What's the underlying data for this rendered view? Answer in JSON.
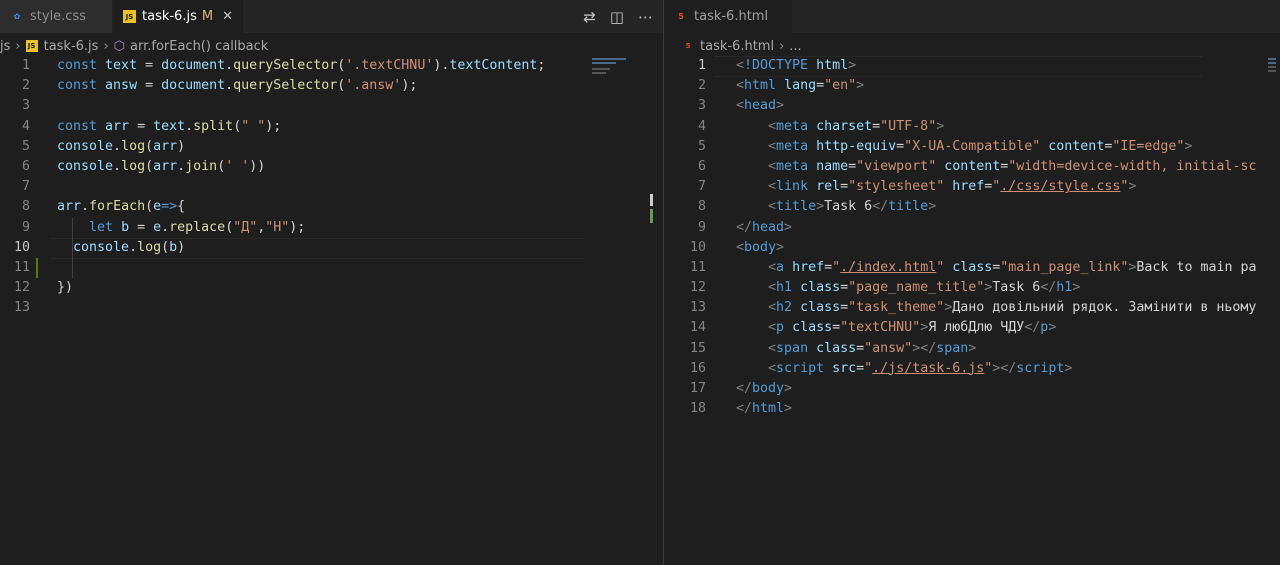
{
  "left": {
    "tabs": [
      {
        "label": "style.css",
        "icon": "css",
        "active": false
      },
      {
        "label": "task-6.js",
        "icon": "js",
        "active": true,
        "modified": "M",
        "close": "✕"
      }
    ],
    "actions": [
      "compare-icon",
      "split-editor-icon",
      "more-icon"
    ],
    "breadcrumb": {
      "folder": "js",
      "file": "task-6.js",
      "symbol": "arr.forEach() callback"
    },
    "current_line": 10
  },
  "right": {
    "tabs": [
      {
        "label": "task-6.html",
        "icon": "html",
        "active": true
      }
    ],
    "breadcrumb": {
      "file": "task-6.html",
      "rest": "..."
    },
    "current_line": 1
  },
  "js_lines": [
    {
      "n": "1",
      "tokens": [
        [
          "k",
          "const "
        ],
        [
          "v",
          "text"
        ],
        [
          "p",
          " = "
        ],
        [
          "v",
          "document"
        ],
        [
          "p",
          "."
        ],
        [
          "f",
          "querySelector"
        ],
        [
          "p",
          "("
        ],
        [
          "s",
          "'.textCHNU'"
        ],
        [
          "p",
          ")."
        ],
        [
          "v",
          "textContent"
        ],
        [
          "p",
          ";"
        ]
      ]
    },
    {
      "n": "2",
      "tokens": [
        [
          "k",
          "const "
        ],
        [
          "v",
          "answ"
        ],
        [
          "p",
          " = "
        ],
        [
          "v",
          "document"
        ],
        [
          "p",
          "."
        ],
        [
          "f",
          "querySelector"
        ],
        [
          "p",
          "("
        ],
        [
          "s",
          "'.answ'"
        ],
        [
          "p",
          ");"
        ]
      ]
    },
    {
      "n": "3",
      "tokens": []
    },
    {
      "n": "4",
      "tokens": [
        [
          "k",
          "const "
        ],
        [
          "v",
          "arr"
        ],
        [
          "p",
          " = "
        ],
        [
          "v",
          "text"
        ],
        [
          "p",
          "."
        ],
        [
          "f",
          "split"
        ],
        [
          "p",
          "("
        ],
        [
          "s",
          "\" \""
        ],
        [
          "p",
          ");"
        ]
      ]
    },
    {
      "n": "5",
      "tokens": [
        [
          "v",
          "console"
        ],
        [
          "p",
          "."
        ],
        [
          "f",
          "log"
        ],
        [
          "p",
          "("
        ],
        [
          "v",
          "arr"
        ],
        [
          "p",
          ")"
        ]
      ]
    },
    {
      "n": "6",
      "tokens": [
        [
          "v",
          "console"
        ],
        [
          "p",
          "."
        ],
        [
          "f",
          "log"
        ],
        [
          "p",
          "("
        ],
        [
          "v",
          "arr"
        ],
        [
          "p",
          "."
        ],
        [
          "f",
          "join"
        ],
        [
          "p",
          "("
        ],
        [
          "s",
          "' '"
        ],
        [
          "p",
          "))"
        ]
      ]
    },
    {
      "n": "7",
      "tokens": []
    },
    {
      "n": "8",
      "tokens": [
        [
          "v",
          "arr"
        ],
        [
          "p",
          "."
        ],
        [
          "f",
          "forEach"
        ],
        [
          "p",
          "("
        ],
        [
          "v",
          "e"
        ],
        [
          "k",
          "=>"
        ],
        [
          "p",
          "{"
        ]
      ]
    },
    {
      "n": "9",
      "tokens": [
        [
          "p",
          "    "
        ],
        [
          "k",
          "let "
        ],
        [
          "v",
          "b"
        ],
        [
          "p",
          " = "
        ],
        [
          "v",
          "e"
        ],
        [
          "p",
          "."
        ],
        [
          "f",
          "replace"
        ],
        [
          "p",
          "("
        ],
        [
          "s",
          "\"Д\""
        ],
        [
          "p",
          ","
        ],
        [
          "s",
          "\"Н\""
        ],
        [
          "p",
          ");"
        ]
      ]
    },
    {
      "n": "10",
      "tokens": [
        [
          "p",
          "  "
        ],
        [
          "v",
          "console"
        ],
        [
          "p",
          "."
        ],
        [
          "f",
          "log"
        ],
        [
          "p",
          "("
        ],
        [
          "v",
          "b"
        ],
        [
          "p",
          ")"
        ]
      ]
    },
    {
      "n": "11",
      "tokens": []
    },
    {
      "n": "12",
      "tokens": [
        [
          "p",
          "})"
        ]
      ]
    },
    {
      "n": "13",
      "tokens": []
    }
  ],
  "html_lines": [
    {
      "n": "1",
      "tokens": [
        [
          "g",
          "<"
        ],
        [
          "t",
          "!DOCTYPE"
        ],
        [
          "p",
          " "
        ],
        [
          "a",
          "html"
        ],
        [
          "g",
          ">"
        ]
      ]
    },
    {
      "n": "2",
      "tokens": [
        [
          "g",
          "<"
        ],
        [
          "t",
          "html"
        ],
        [
          "p",
          " "
        ],
        [
          "a",
          "lang"
        ],
        [
          "p",
          "="
        ],
        [
          "s",
          "\"en\""
        ],
        [
          "g",
          ">"
        ]
      ]
    },
    {
      "n": "3",
      "tokens": [
        [
          "g",
          "<"
        ],
        [
          "t",
          "head"
        ],
        [
          "g",
          ">"
        ]
      ]
    },
    {
      "n": "4",
      "tokens": [
        [
          "p",
          "    "
        ],
        [
          "g",
          "<"
        ],
        [
          "t",
          "meta"
        ],
        [
          "p",
          " "
        ],
        [
          "a",
          "charset"
        ],
        [
          "p",
          "="
        ],
        [
          "s",
          "\"UTF-8\""
        ],
        [
          "g",
          ">"
        ]
      ]
    },
    {
      "n": "5",
      "tokens": [
        [
          "p",
          "    "
        ],
        [
          "g",
          "<"
        ],
        [
          "t",
          "meta"
        ],
        [
          "p",
          " "
        ],
        [
          "a",
          "http-equiv"
        ],
        [
          "p",
          "="
        ],
        [
          "s",
          "\"X-UA-Compatible\""
        ],
        [
          "p",
          " "
        ],
        [
          "a",
          "content"
        ],
        [
          "p",
          "="
        ],
        [
          "s",
          "\"IE=edge\""
        ],
        [
          "g",
          ">"
        ]
      ]
    },
    {
      "n": "6",
      "tokens": [
        [
          "p",
          "    "
        ],
        [
          "g",
          "<"
        ],
        [
          "t",
          "meta"
        ],
        [
          "p",
          " "
        ],
        [
          "a",
          "name"
        ],
        [
          "p",
          "="
        ],
        [
          "s",
          "\"viewport\""
        ],
        [
          "p",
          " "
        ],
        [
          "a",
          "content"
        ],
        [
          "p",
          "="
        ],
        [
          "s",
          "\"width=device-width, initial-sc"
        ]
      ]
    },
    {
      "n": "7",
      "tokens": [
        [
          "p",
          "    "
        ],
        [
          "g",
          "<"
        ],
        [
          "t",
          "link"
        ],
        [
          "p",
          " "
        ],
        [
          "a",
          "rel"
        ],
        [
          "p",
          "="
        ],
        [
          "s",
          "\"stylesheet\""
        ],
        [
          "p",
          " "
        ],
        [
          "a",
          "href"
        ],
        [
          "p",
          "="
        ],
        [
          "s",
          "\""
        ],
        [
          "su",
          "./css/style.css"
        ],
        [
          "s",
          "\""
        ],
        [
          "g",
          ">"
        ]
      ]
    },
    {
      "n": "8",
      "tokens": [
        [
          "p",
          "    "
        ],
        [
          "g",
          "<"
        ],
        [
          "t",
          "title"
        ],
        [
          "g",
          ">"
        ],
        [
          "p",
          "Task 6"
        ],
        [
          "g",
          "</"
        ],
        [
          "t",
          "title"
        ],
        [
          "g",
          ">"
        ]
      ]
    },
    {
      "n": "9",
      "tokens": [
        [
          "g",
          "</"
        ],
        [
          "t",
          "head"
        ],
        [
          "g",
          ">"
        ]
      ]
    },
    {
      "n": "10",
      "tokens": [
        [
          "g",
          "<"
        ],
        [
          "t",
          "body"
        ],
        [
          "g",
          ">"
        ]
      ]
    },
    {
      "n": "11",
      "tokens": [
        [
          "p",
          "    "
        ],
        [
          "g",
          "<"
        ],
        [
          "t",
          "a"
        ],
        [
          "p",
          " "
        ],
        [
          "a",
          "href"
        ],
        [
          "p",
          "="
        ],
        [
          "s",
          "\""
        ],
        [
          "su",
          "./index.html"
        ],
        [
          "s",
          "\""
        ],
        [
          "p",
          " "
        ],
        [
          "a",
          "class"
        ],
        [
          "p",
          "="
        ],
        [
          "s",
          "\"main_page_link\""
        ],
        [
          "g",
          ">"
        ],
        [
          "p",
          "Back to main pa"
        ]
      ]
    },
    {
      "n": "12",
      "tokens": [
        [
          "p",
          "    "
        ],
        [
          "g",
          "<"
        ],
        [
          "t",
          "h1"
        ],
        [
          "p",
          " "
        ],
        [
          "a",
          "class"
        ],
        [
          "p",
          "="
        ],
        [
          "s",
          "\"page_name_title\""
        ],
        [
          "g",
          ">"
        ],
        [
          "p",
          "Task 6"
        ],
        [
          "g",
          "</"
        ],
        [
          "t",
          "h1"
        ],
        [
          "g",
          ">"
        ]
      ]
    },
    {
      "n": "13",
      "tokens": [
        [
          "p",
          "    "
        ],
        [
          "g",
          "<"
        ],
        [
          "t",
          "h2"
        ],
        [
          "p",
          " "
        ],
        [
          "a",
          "class"
        ],
        [
          "p",
          "="
        ],
        [
          "s",
          "\"task_theme\""
        ],
        [
          "g",
          ">"
        ],
        [
          "p",
          "Дано довільний рядок. Замінити в ньому"
        ]
      ]
    },
    {
      "n": "14",
      "tokens": [
        [
          "p",
          "    "
        ],
        [
          "g",
          "<"
        ],
        [
          "t",
          "p"
        ],
        [
          "p",
          " "
        ],
        [
          "a",
          "class"
        ],
        [
          "p",
          "="
        ],
        [
          "s",
          "\"textCHNU\""
        ],
        [
          "g",
          ">"
        ],
        [
          "p",
          "Я любДлю ЧДУ"
        ],
        [
          "g",
          "</"
        ],
        [
          "t",
          "p"
        ],
        [
          "g",
          ">"
        ]
      ]
    },
    {
      "n": "15",
      "tokens": [
        [
          "p",
          "    "
        ],
        [
          "g",
          "<"
        ],
        [
          "t",
          "span"
        ],
        [
          "p",
          " "
        ],
        [
          "a",
          "class"
        ],
        [
          "p",
          "="
        ],
        [
          "s",
          "\"answ\""
        ],
        [
          "g",
          "></"
        ],
        [
          "t",
          "span"
        ],
        [
          "g",
          ">"
        ]
      ]
    },
    {
      "n": "16",
      "tokens": [
        [
          "p",
          "    "
        ],
        [
          "g",
          "<"
        ],
        [
          "t",
          "script"
        ],
        [
          "p",
          " "
        ],
        [
          "a",
          "src"
        ],
        [
          "p",
          "="
        ],
        [
          "s",
          "\""
        ],
        [
          "su",
          "./js/task-6.js"
        ],
        [
          "s",
          "\""
        ],
        [
          "g",
          "></"
        ],
        [
          "t",
          "script"
        ],
        [
          "g",
          ">"
        ]
      ]
    },
    {
      "n": "17",
      "tokens": [
        [
          "g",
          "</"
        ],
        [
          "t",
          "body"
        ],
        [
          "g",
          ">"
        ]
      ]
    },
    {
      "n": "18",
      "tokens": [
        [
          "g",
          "</"
        ],
        [
          "t",
          "html"
        ],
        [
          "g",
          ">"
        ]
      ]
    }
  ]
}
